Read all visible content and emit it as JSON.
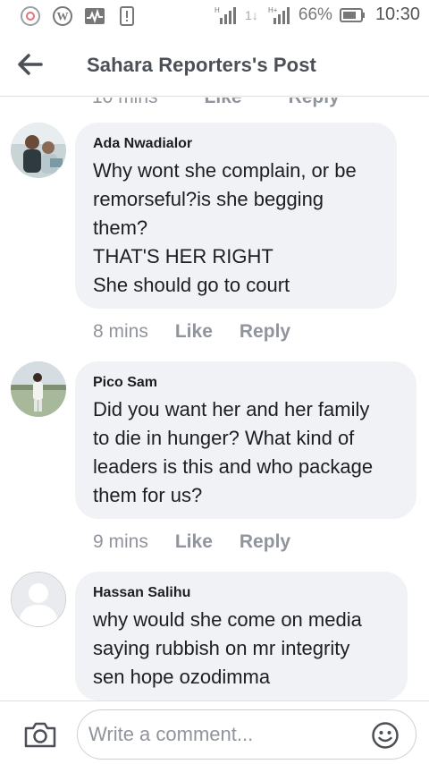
{
  "status_bar": {
    "battery": "66%",
    "time": "10:30",
    "icons": [
      "chrome-icon",
      "wordpress-icon",
      "activity-icon",
      "sim-alert-icon",
      "signal-icon",
      "data-arrows-icon",
      "signal-h-icon",
      "battery-icon"
    ]
  },
  "header": {
    "title": "Sahara Reporters's Post",
    "back_icon": "arrow-left-icon"
  },
  "cut_off_actions": {
    "time": "10 mins",
    "like": "Like",
    "reply": "Reply"
  },
  "comments": [
    {
      "author": "Ada Nwadialor",
      "lines": [
        "Why wont she complain, or be",
        "remorseful?is she begging",
        "them?",
        "THAT'S HER RIGHT",
        "She should go to court"
      ],
      "time": "8 mins",
      "like": "Like",
      "reply": "Reply",
      "avatar": "photo"
    },
    {
      "author": "Pico Sam",
      "lines": [
        "Did you want her and her family",
        "to die in hunger? What kind of",
        "leaders is this and who package",
        "them for us?"
      ],
      "time": "9 mins",
      "like": "Like",
      "reply": "Reply",
      "avatar": "photo"
    },
    {
      "author": "Hassan Salihu",
      "lines": [
        "why would she come on media",
        "saying rubbish on mr integrity",
        "sen hope ozodimma"
      ],
      "avatar": "default-silhouette"
    }
  ],
  "composer": {
    "placeholder": "Write a comment...",
    "camera_icon": "camera-icon",
    "emoji_icon": "smiley-icon"
  },
  "colors": {
    "bubble_bg": "#f0f2f5",
    "meta_text": "#90949c",
    "header_text": "#4b4f56",
    "divider": "#dddfe2"
  }
}
